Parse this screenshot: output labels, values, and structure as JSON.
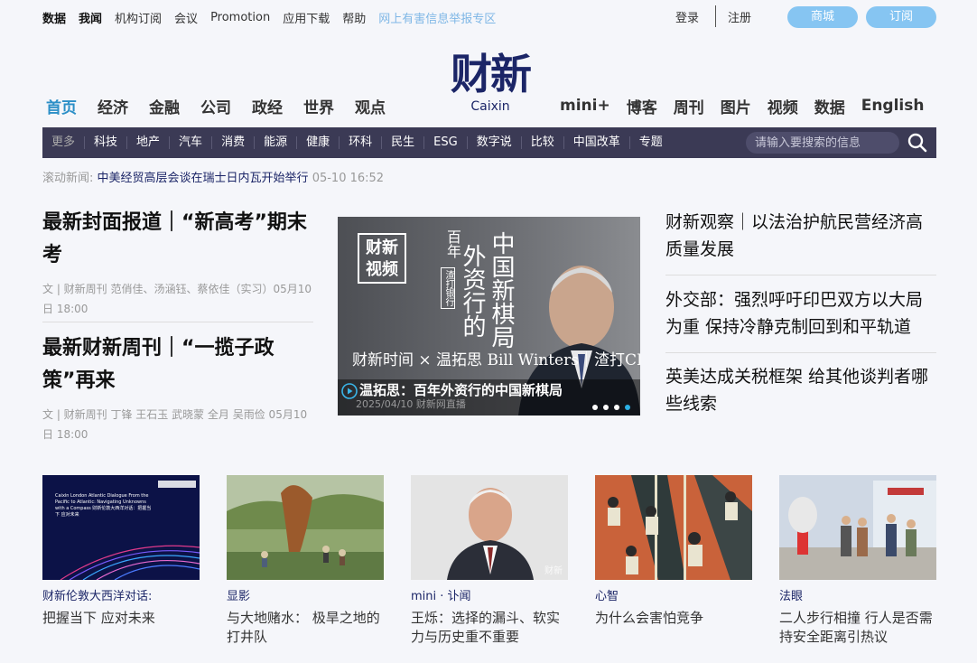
{
  "topbar": {
    "links": [
      "数据",
      "我闻",
      "机构订阅",
      "会议",
      "Promotion",
      "应用下载",
      "帮助"
    ],
    "report": "网上有害信息举报专区",
    "login": "登录",
    "register": "注册",
    "shop": "商城",
    "subscribe": "订阅"
  },
  "logo": {
    "cn": "财新",
    "en": "Caixin"
  },
  "mainnav": {
    "left": [
      "首页",
      "经济",
      "金融",
      "公司",
      "政经",
      "世界",
      "观点"
    ],
    "right": [
      "mini+",
      "博客",
      "周刊",
      "图片",
      "视频",
      "数据",
      "English"
    ]
  },
  "catbar": {
    "items": [
      "更多",
      "科技",
      "地产",
      "汽车",
      "消费",
      "能源",
      "健康",
      "环科",
      "民生",
      "ESG",
      "数字说",
      "比较",
      "中国改革",
      "专题"
    ],
    "search_placeholder": "请输入要搜索的信息"
  },
  "ticker": {
    "label": "滚动新闻:",
    "headline": "中美经贸高层会谈在瑞士日内瓦开始举行",
    "time": "05-10 16:52"
  },
  "left_stories": [
    {
      "title": "最新封面报道｜“新高考”期末考",
      "meta": "文 | 财新周刊 范俏佳、汤涵钰、蔡依佳（实习）05月10日 18:00"
    },
    {
      "title": "最新财新周刊｜“一揽子政策”再来",
      "meta": "文 | 财新周刊 丁锋 王石玉 武晓蒙 全月 吴雨俭 05月10日 18:00"
    }
  ],
  "video": {
    "tag": "财新视频",
    "vert_a": "百年",
    "vert_b": "外资行的",
    "vert_c": "中国新棋局",
    "badge": "渣打银行",
    "line1": "财新时间 × 温拓思 Bill Winters｜渣打CEO",
    "date": "2025/04/10 财新网直播",
    "caption": "温拓思：百年外资行的中国新棋局"
  },
  "right_stories": [
    "财新观察｜以法治护航民营经济高质量发展",
    "外交部：强烈呼吁印巴双方以大局为重 保持冷静克制回到和平轨道",
    "英美达成关税框架 给其他谈判者哪些线索"
  ],
  "cards": [
    {
      "cat": "财新伦敦大西洋对话:",
      "title": "把握当下 应对未来",
      "thumb_text": "Caixin London Atlantic Dialogue  From the Pacific to Atlantic: Navigating Unknowns with a Compass  财新伦敦大西洋对话：把握当下 应对未来"
    },
    {
      "cat": "显影",
      "title": "与大地赌水： 极旱之地的打井队"
    },
    {
      "cat": "mini · 讣闻",
      "title": "王烁：选择的漏斗、软实力与历史重不重要",
      "thumb_text": "财新"
    },
    {
      "cat": "心智",
      "title": "为什么会害怕竞争"
    },
    {
      "cat": "法眼",
      "title": "二人步行相撞 行人是否需持安全距离引热议"
    }
  ],
  "colors": {
    "brand": "#1b2567",
    "accent": "#2b8fc7",
    "catbar": "#3b3a55",
    "pill": "#86c5f2"
  }
}
